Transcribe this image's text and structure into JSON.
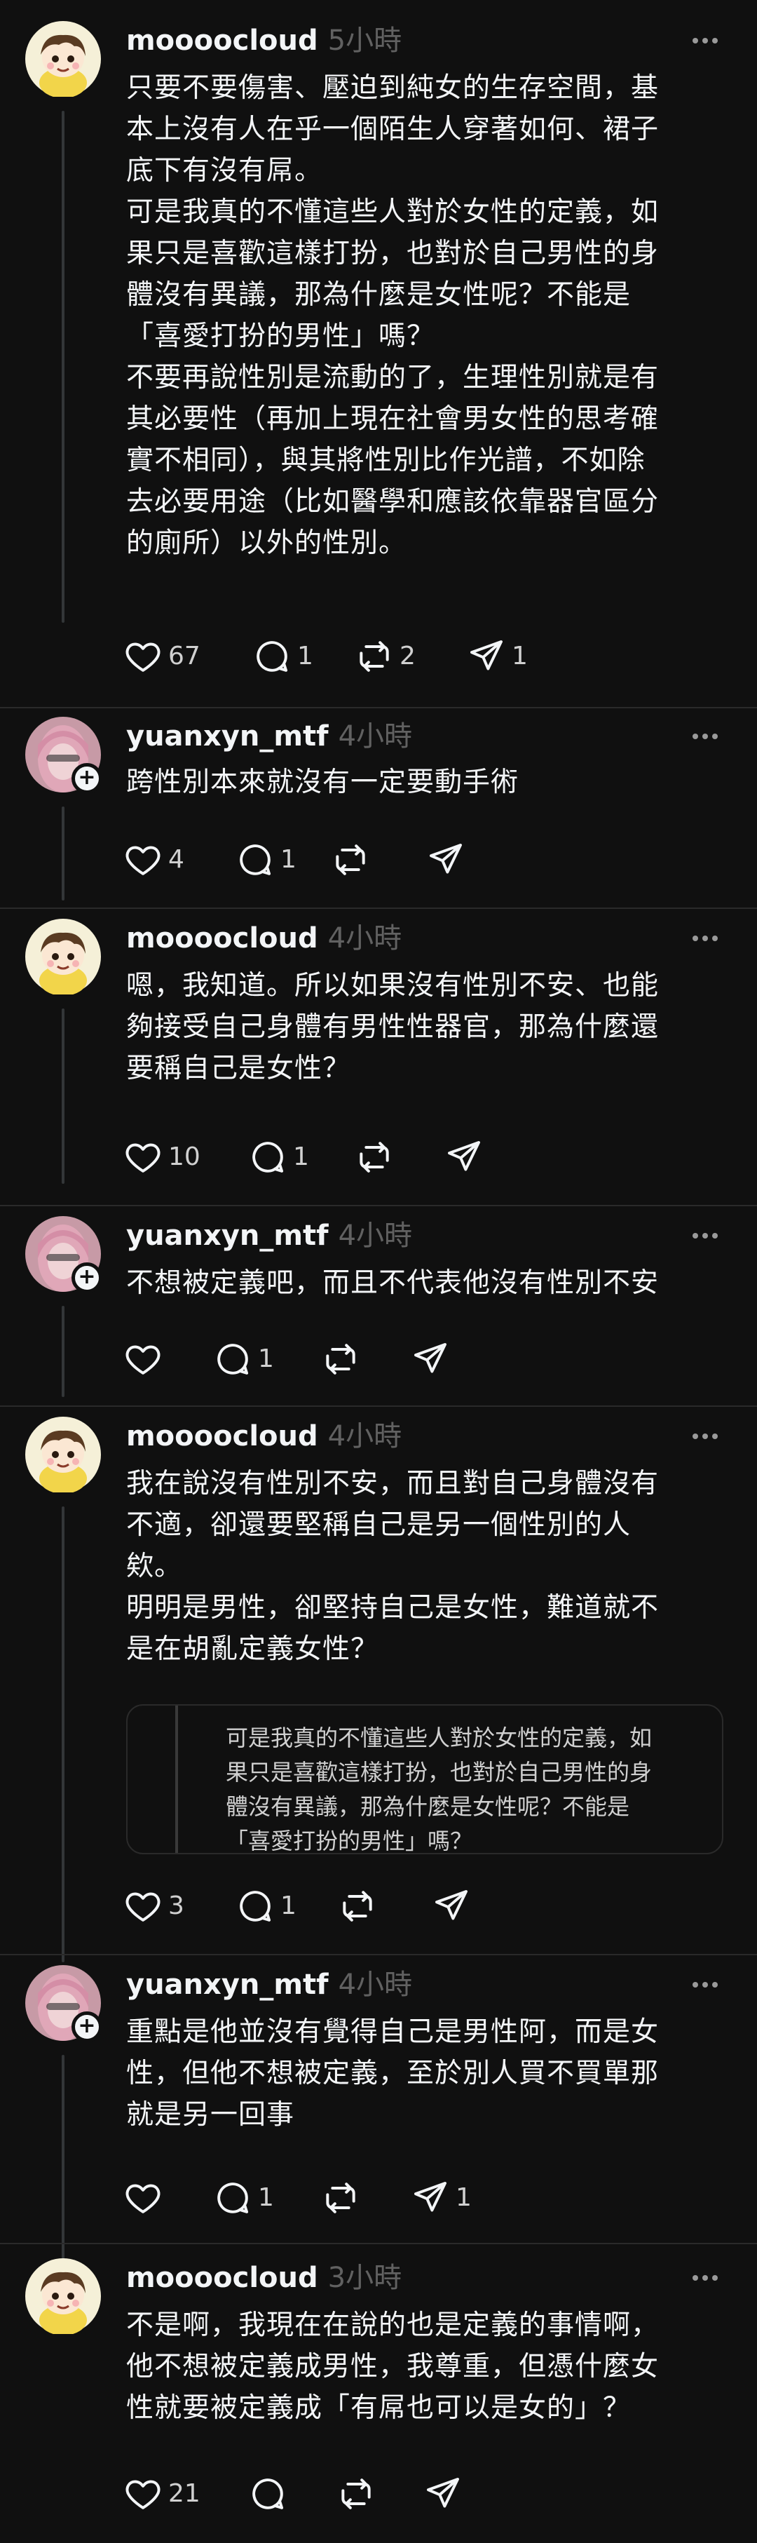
{
  "posts": [
    {
      "username": "moooocloud",
      "time": "5小時",
      "text": "只要不要傷害、壓迫到純女的生存空間，基\n本上沒有人在乎一個陌生人穿著如何、裙子\n底下有沒有屌。\n可是我真的不懂這些人對於女性的定義，如\n果只是喜歡這樣打扮，也對於自己男性的身\n體沒有異議，那為什麼是女性呢？不能是\n「喜愛打扮的男性」嗎？\n不要再說性別是流動的了，生理性別就是有\n其必要性（再加上現在社會男女性的思考確\n實不相同），與其將性別比作光譜，不如除\n去必要用途（比如醫學和應該依靠器官區分\n的廁所）以外的性別。",
      "likes": "67",
      "replies": "1",
      "reposts": "2",
      "shares": "1"
    },
    {
      "username": "yuanxyn_mtf",
      "time": "4小時",
      "text": "跨性別本來就沒有一定要動手術",
      "likes": "4",
      "replies": "1",
      "reposts": "",
      "shares": ""
    },
    {
      "username": "moooocloud",
      "time": "4小時",
      "text": "嗯，我知道。所以如果沒有性別不安、也能\n夠接受自己身體有男性性器官，那為什麼還\n要稱自己是女性？",
      "likes": "10",
      "replies": "1",
      "reposts": "",
      "shares": ""
    },
    {
      "username": "yuanxyn_mtf",
      "time": "4小時",
      "text": "不想被定義吧，而且不代表他沒有性別不安",
      "likes": "",
      "replies": "1",
      "reposts": "",
      "shares": ""
    },
    {
      "username": "moooocloud",
      "time": "4小時",
      "text": "我在說沒有性別不安，而且對自己身體沒有\n不適，卻還要堅稱自己是另一個性別的人\n欸。\n明明是男性，卻堅持自己是女性，難道就不\n是在胡亂定義女性？",
      "quote": "可是我真的不懂這些人對於女性的定義，如\n果只是喜歡這樣打扮，也對於自己男性的身\n體沒有異議，那為什麼是女性呢？不能是\n「喜愛打扮的男性」嗎？",
      "likes": "3",
      "replies": "1",
      "reposts": "",
      "shares": ""
    },
    {
      "username": "yuanxyn_mtf",
      "time": "4小時",
      "text": "重點是他並沒有覺得自己是男性阿，而是女\n性，但他不想被定義，至於別人買不買單那\n就是另一回事",
      "likes": "",
      "replies": "1",
      "reposts": "",
      "shares": "1"
    },
    {
      "username": "moooocloud",
      "time": "3小時",
      "text": "不是啊，我現在在說的也是定義的事情啊，\n他不想被定義成男性，我尊重，但憑什麼女\n性就要被定義成「有屌也可以是女的」？",
      "likes": "21",
      "replies": "",
      "reposts": "",
      "shares": ""
    }
  ],
  "icons": {
    "like": "heart-icon",
    "reply": "comment-icon",
    "repost": "repost-icon",
    "share": "send-icon",
    "more": "more-icon",
    "follow": "plus-icon"
  },
  "colors": {
    "background": "#101010",
    "text": "#f3f5f7",
    "muted": "#616161",
    "line": "#333638"
  }
}
